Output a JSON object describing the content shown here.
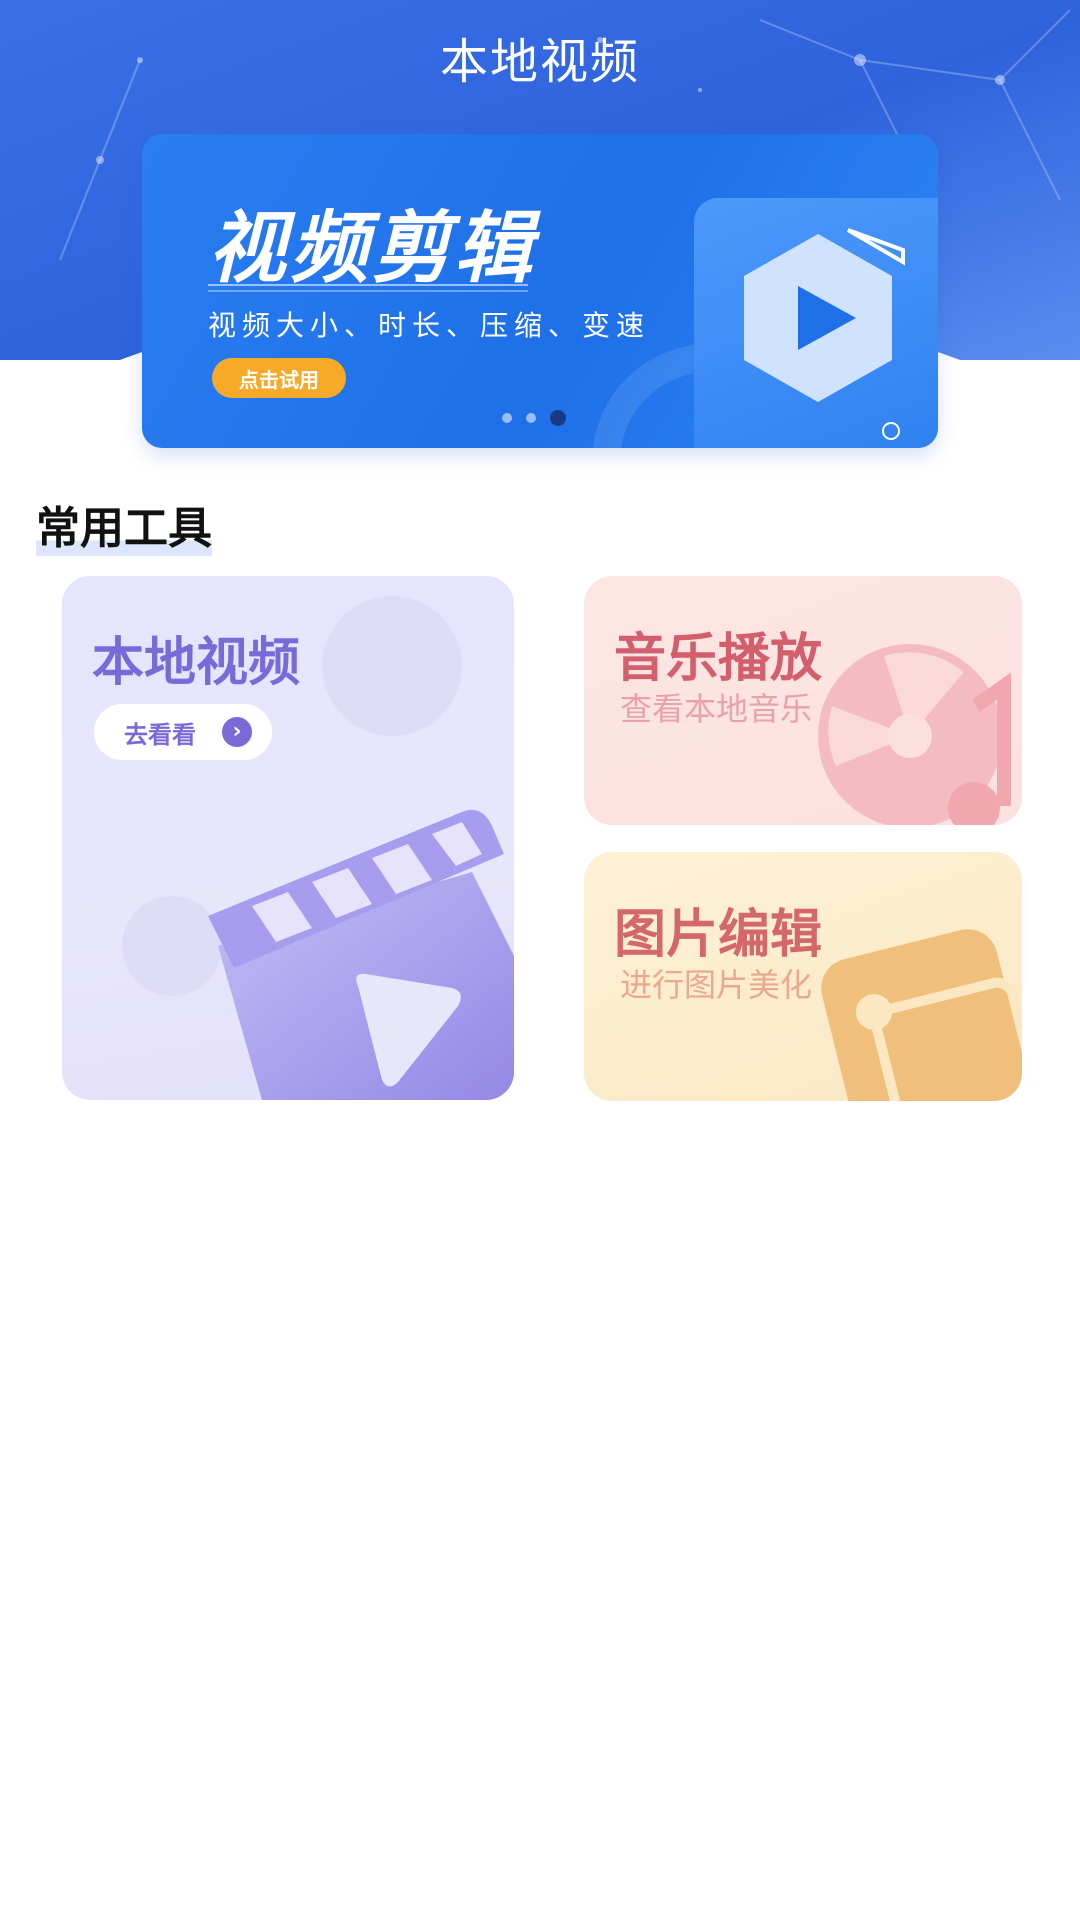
{
  "header": {
    "title": "本地视频"
  },
  "banner": {
    "title": "视频剪辑",
    "subtitle": "视频大小、时长、压缩、变速",
    "button_label": "点击试用",
    "dots": 3,
    "active_dot": 2
  },
  "section": {
    "title": "常用工具"
  },
  "tools": {
    "video": {
      "title": "本地视频",
      "button_label": "去看看",
      "icon": "video-clapper-icon"
    },
    "music": {
      "title": "音乐播放",
      "subtitle": "查看本地音乐",
      "icon": "music-disc-icon"
    },
    "photo": {
      "title": "图片编辑",
      "subtitle": "进行图片美化",
      "icon": "picture-icon"
    }
  },
  "colors": {
    "header_blue": "#3a6fe6",
    "banner_blue": "#1e6fe8",
    "banner_button": "#f7a928",
    "video_accent": "#7a6ad8",
    "music_accent": "#d45f6c",
    "photo_accent": "#d4676c"
  }
}
